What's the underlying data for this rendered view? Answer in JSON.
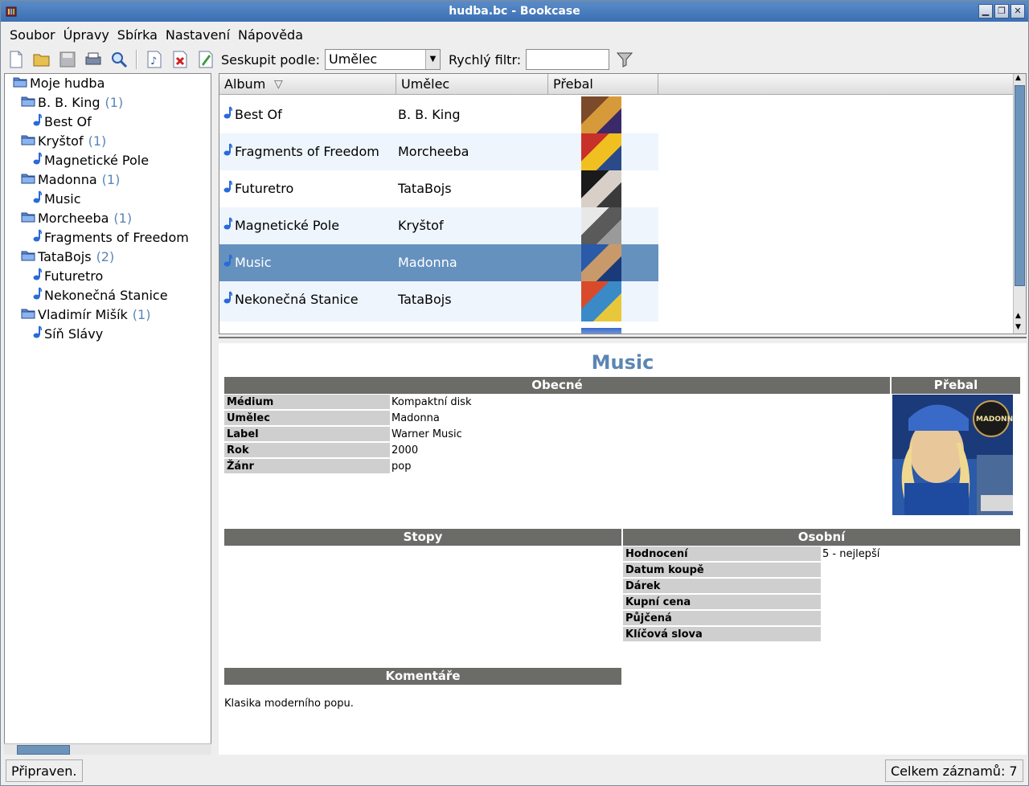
{
  "window": {
    "title": "hudba.bc - Bookcase"
  },
  "menu": [
    "Soubor",
    "Úpravy",
    "Sbírka",
    "Nastavení",
    "Nápověda"
  ],
  "toolbar": {
    "group_by_label": "Seskupit podle:",
    "group_by_value": "Umělec",
    "quick_filter_label": "Rychlý filtr:",
    "quick_filter_value": ""
  },
  "tree": {
    "root": "Moje hudba",
    "groups": [
      {
        "name": "B. B. King",
        "count": "(1)",
        "albums": [
          "Best Of"
        ]
      },
      {
        "name": "Kryštof",
        "count": "(1)",
        "albums": [
          "Magnetické Pole"
        ]
      },
      {
        "name": "Madonna",
        "count": "(1)",
        "albums": [
          "Music"
        ]
      },
      {
        "name": "Morcheeba",
        "count": "(1)",
        "albums": [
          "Fragments of Freedom"
        ]
      },
      {
        "name": "TataBojs",
        "count": "(2)",
        "albums": [
          "Futuretro",
          "Nekonečná Stanice"
        ]
      },
      {
        "name": "Vladimír Mišík",
        "count": "(1)",
        "albums": [
          "Síň Slávy"
        ]
      }
    ]
  },
  "list": {
    "columns": [
      "Album",
      "Umělec",
      "Přebal"
    ],
    "rows": [
      {
        "album": "Best Of",
        "artist": "B. B. King",
        "cover": [
          "#7a4a2a",
          "#d79a3a",
          "#3a2a6a"
        ]
      },
      {
        "album": "Fragments of Freedom",
        "artist": "Morcheeba",
        "cover": [
          "#c8302a",
          "#f0c020",
          "#2a4a8a"
        ]
      },
      {
        "album": "Futuretro",
        "artist": "TataBojs",
        "cover": [
          "#1a1a1a",
          "#d8d0c8",
          "#3a3a3a"
        ]
      },
      {
        "album": "Magnetické Pole",
        "artist": "Kryštof",
        "cover": [
          "#e8e8e8",
          "#5a5a5a",
          "#9a9a9a"
        ]
      },
      {
        "album": "Music",
        "artist": "Madonna",
        "cover": [
          "#2a5aa8",
          "#c89a6a",
          "#1a3a7a"
        ],
        "selected": true
      },
      {
        "album": "Nekonečná Stanice",
        "artist": "TataBojs",
        "cover": [
          "#d84a2a",
          "#3a8ac8",
          "#e8c83a"
        ]
      }
    ]
  },
  "detail": {
    "title": "Music",
    "general_header": "Obecné",
    "cover_header": "Přebal",
    "general": [
      {
        "k": "Médium",
        "v": "Kompaktní disk"
      },
      {
        "k": "Umělec",
        "v": "Madonna"
      },
      {
        "k": "Label",
        "v": "Warner Music"
      },
      {
        "k": "Rok",
        "v": "2000"
      },
      {
        "k": "Žánr",
        "v": "pop"
      }
    ],
    "tracks_header": "Stopy",
    "personal_header": "Osobní",
    "personal": [
      {
        "k": "Hodnocení",
        "v": "5 - nejlepší"
      },
      {
        "k": "Datum koupě",
        "v": ""
      },
      {
        "k": "Dárek",
        "v": ""
      },
      {
        "k": "Kupní cena",
        "v": ""
      },
      {
        "k": "Půjčená",
        "v": ""
      },
      {
        "k": "Klíčová slova",
        "v": ""
      }
    ],
    "comments_header": "Komentáře",
    "comments": "Klasika moderního popu.",
    "cover_art_text": "MADONNA"
  },
  "status": {
    "left": "Připraven.",
    "right": "Celkem záznamů: 7"
  }
}
